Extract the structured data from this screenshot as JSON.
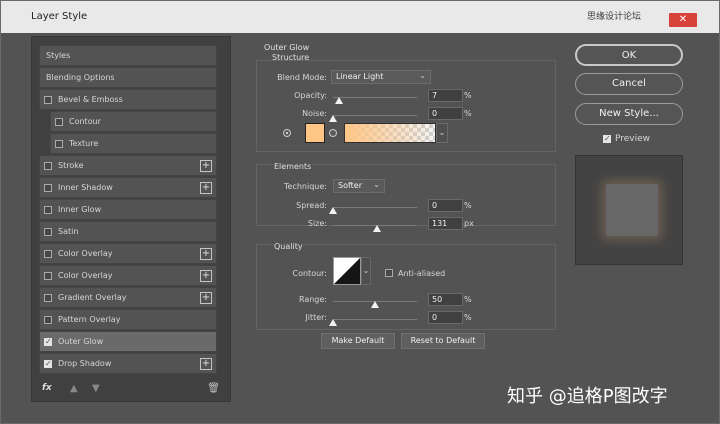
{
  "window": {
    "title": "Layer Style",
    "top_watermark": "思缘设计论坛",
    "close_icon": "close-icon"
  },
  "sidebar": {
    "items": [
      {
        "label": "Styles",
        "checkbox": false,
        "checked": false,
        "indent": false,
        "plus": false
      },
      {
        "label": "Blending Options",
        "checkbox": false,
        "checked": false,
        "indent": false,
        "plus": false
      },
      {
        "label": "Bevel & Emboss",
        "checkbox": true,
        "checked": false,
        "indent": false,
        "plus": false
      },
      {
        "label": "Contour",
        "checkbox": true,
        "checked": false,
        "indent": true,
        "plus": false
      },
      {
        "label": "Texture",
        "checkbox": true,
        "checked": false,
        "indent": true,
        "plus": false
      },
      {
        "label": "Stroke",
        "checkbox": true,
        "checked": false,
        "indent": false,
        "plus": true
      },
      {
        "label": "Inner Shadow",
        "checkbox": true,
        "checked": false,
        "indent": false,
        "plus": true
      },
      {
        "label": "Inner Glow",
        "checkbox": true,
        "checked": false,
        "indent": false,
        "plus": false
      },
      {
        "label": "Satin",
        "checkbox": true,
        "checked": false,
        "indent": false,
        "plus": false
      },
      {
        "label": "Color Overlay",
        "checkbox": true,
        "checked": false,
        "indent": false,
        "plus": true
      },
      {
        "label": "Color Overlay",
        "checkbox": true,
        "checked": false,
        "indent": false,
        "plus": true
      },
      {
        "label": "Gradient Overlay",
        "checkbox": true,
        "checked": false,
        "indent": false,
        "plus": true
      },
      {
        "label": "Pattern Overlay",
        "checkbox": true,
        "checked": false,
        "indent": false,
        "plus": false
      },
      {
        "label": "Outer Glow",
        "checkbox": true,
        "checked": true,
        "indent": false,
        "plus": false,
        "active": true
      },
      {
        "label": "Drop Shadow",
        "checkbox": true,
        "checked": true,
        "indent": false,
        "plus": true
      }
    ],
    "footer": {
      "fx_label": "fx",
      "up_icon": "arrow-up-icon",
      "down_icon": "arrow-down-icon",
      "trash_icon": "trash-icon"
    }
  },
  "outer_glow": {
    "title": "Outer Glow",
    "structure": {
      "title": "Structure",
      "blend_mode_label": "Blend Mode:",
      "blend_mode_value": "Linear Light",
      "opacity_label": "Opacity:",
      "opacity_value": "7",
      "opacity_percent": 7,
      "opacity_unit": "%",
      "noise_label": "Noise:",
      "noise_value": "0",
      "noise_percent": 0,
      "noise_unit": "%",
      "glow_color": "#ffc585"
    },
    "elements": {
      "title": "Elements",
      "technique_label": "Technique:",
      "technique_value": "Softer",
      "spread_label": "Spread:",
      "spread_value": "0",
      "spread_percent": 0,
      "spread_unit": "%",
      "size_label": "Size:",
      "size_value": "131",
      "size_fraction": 0.52,
      "size_unit": "px"
    },
    "quality": {
      "title": "Quality",
      "contour_label": "Contour:",
      "anti_aliased_label": "Anti-aliased",
      "range_label": "Range:",
      "range_value": "50",
      "range_percent": 50,
      "range_unit": "%",
      "jitter_label": "Jitter:",
      "jitter_value": "0",
      "jitter_percent": 0,
      "jitter_unit": "%"
    },
    "buttons": {
      "make_default": "Make Default",
      "reset_default": "Reset to Default"
    }
  },
  "actions": {
    "ok": "OK",
    "cancel": "Cancel",
    "new_style": "New Style...",
    "preview_label": "Preview",
    "preview_checked": true
  },
  "bottom_watermark": "知乎 @追格P图改字"
}
